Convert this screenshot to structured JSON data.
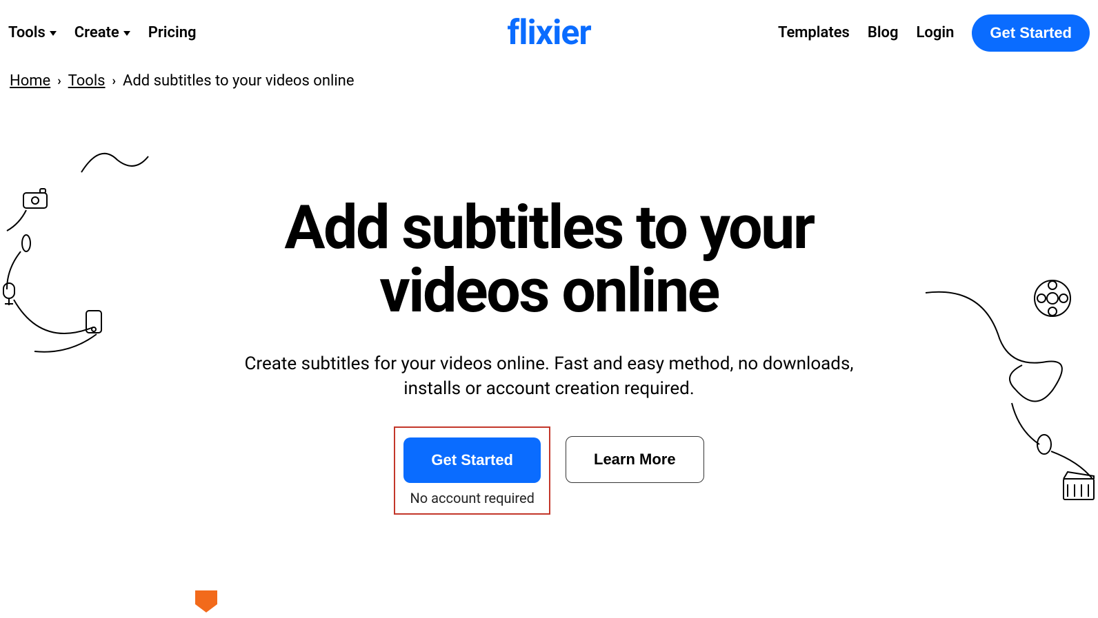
{
  "nav": {
    "left": [
      {
        "label": "Tools",
        "hasCaret": true
      },
      {
        "label": "Create",
        "hasCaret": true
      },
      {
        "label": "Pricing",
        "hasCaret": false
      }
    ],
    "right": [
      {
        "label": "Templates"
      },
      {
        "label": "Blog"
      },
      {
        "label": "Login"
      }
    ],
    "cta": "Get Started"
  },
  "logo": "flixier",
  "breadcrumb": {
    "items": [
      "Home",
      "Tools"
    ],
    "current": "Add subtitles to your videos online"
  },
  "hero": {
    "title": "Add subtitles to your videos online",
    "subtitle": "Create subtitles for your videos online. Fast and easy method, no downloads, installs or account creation required.",
    "primary_cta": "Get Started",
    "primary_hint": "No account required",
    "secondary_cta": "Learn More"
  },
  "colors": {
    "accent": "#0a6cff",
    "highlight_border": "#c33629"
  }
}
